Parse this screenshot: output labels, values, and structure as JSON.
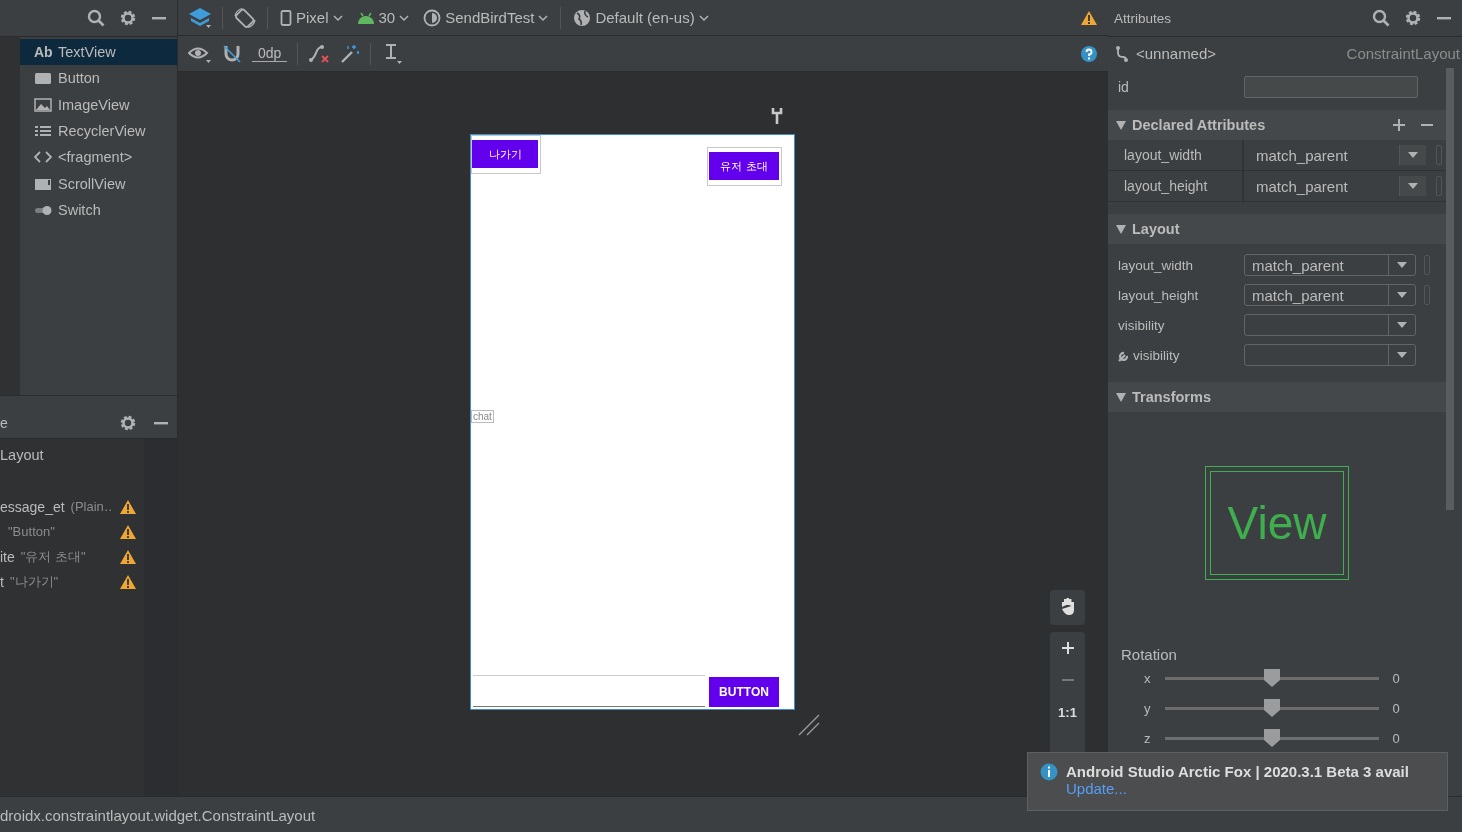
{
  "palette": {
    "items": [
      {
        "kind": "text",
        "icon_text": "Ab",
        "label": "TextView",
        "selected": true
      },
      {
        "kind": "button",
        "label": "Button",
        "selected": false
      },
      {
        "kind": "image",
        "label": "ImageView",
        "selected": false
      },
      {
        "kind": "list",
        "label": "RecyclerView",
        "selected": false
      },
      {
        "kind": "code",
        "label": "<fragment>",
        "selected": false
      },
      {
        "kind": "scroll",
        "label": "ScrollView",
        "selected": false
      },
      {
        "kind": "switch",
        "label": "Switch",
        "selected": false
      }
    ]
  },
  "component_tree": {
    "title": "e",
    "root": "Layout",
    "items": [
      {
        "name": "essage_et",
        "detail": "(Plain…",
        "warning": true
      },
      {
        "detail": "\"Button\"",
        "warning": true
      },
      {
        "name": "ite",
        "detail": "\"유저 초대\"",
        "warning": true
      },
      {
        "name": "t",
        "detail": "\"나가기\"",
        "warning": true
      }
    ]
  },
  "toolbar": {
    "device": "Pixel",
    "api": "30",
    "theme": "SendBirdTest",
    "locale": "Default (en-us)",
    "margin": "0dp"
  },
  "design": {
    "top_left_button": "나가기",
    "top_right_button": "유저 초대",
    "chat_label": "chat",
    "bottom_button": "BUTTON",
    "zoom_actual": "1:1"
  },
  "attributes": {
    "title": "Attributes",
    "component_name": "<unnamed>",
    "component_type": "ConstraintLayout",
    "id_label": "id",
    "sections": [
      {
        "title": "Declared Attributes",
        "kind": "table",
        "rows": [
          {
            "name": "layout_width",
            "value": "match_parent"
          },
          {
            "name": "layout_height",
            "value": "match_parent"
          }
        ]
      },
      {
        "title": "Layout",
        "kind": "form",
        "rows": [
          {
            "name": "layout_width",
            "value": "match_parent",
            "tool": false
          },
          {
            "name": "layout_height",
            "value": "match_parent",
            "tool": false
          },
          {
            "name": "visibility",
            "tool": false
          },
          {
            "name": "visibility",
            "tool": true
          }
        ]
      },
      {
        "title": "Transforms",
        "kind": "transforms",
        "preview": "View",
        "rotation_label": "Rotation",
        "sliders": [
          {
            "axis": "x",
            "level": 0.5,
            "reading": "0"
          },
          {
            "axis": "y",
            "level": 0.5,
            "reading": "0"
          },
          {
            "axis": "z",
            "level": 0.5,
            "reading": "0"
          }
        ]
      }
    ]
  },
  "notification": {
    "title": "Android Studio Arctic Fox | 2020.3.1 Beta 3 avail",
    "link": "Update..."
  },
  "status_bar": {
    "path": "droidx.constraintlayout.widget.ConstraintLayout"
  }
}
